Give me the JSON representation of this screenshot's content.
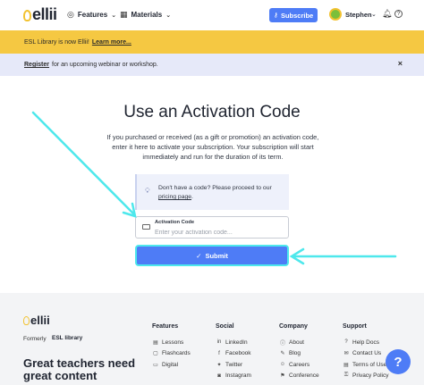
{
  "header": {
    "logo_text": "ellii",
    "nav": [
      {
        "label": "Features",
        "icon": "globe-icon"
      },
      {
        "label": "Materials",
        "icon": "grid-icon"
      }
    ],
    "subscribe_label": "Subscribe",
    "user_name": "Stephen"
  },
  "banners": {
    "yellow": {
      "text": "ESL Library is now Ellii!",
      "link": "Learn more..."
    },
    "blue": {
      "link": "Register",
      "text": "for an upcoming webinar or workshop.",
      "close": "×"
    }
  },
  "main": {
    "title": "Use an Activation Code",
    "description": "If you purchased or received (as a gift or promotion) an activation code, enter it here to activate your subscription. Your subscription will start immediately and run for the duration of its term.",
    "info_text": "Don't have a code? Please proceed to our",
    "info_link": "pricing page",
    "info_end": ".",
    "field_label": "Activation Code",
    "field_placeholder": "Enter your activation code...",
    "field_value": "",
    "submit_label": "Submit"
  },
  "annotations": {
    "arrow_color": "#4ee8ec"
  },
  "footer": {
    "logo_text": "ellii",
    "formerly_label": "Formerly",
    "formerly_brand": "ESL library",
    "tagline": "Great teachers need great content",
    "columns": [
      {
        "title": "Features",
        "items": [
          {
            "label": "Lessons",
            "icon": "book-icon"
          },
          {
            "label": "Flashcards",
            "icon": "cards-icon"
          },
          {
            "label": "Digital",
            "icon": "screen-icon"
          }
        ]
      },
      {
        "title": "Social",
        "items": [
          {
            "label": "LinkedIn",
            "icon": "linkedin-icon"
          },
          {
            "label": "Facebook",
            "icon": "facebook-icon"
          },
          {
            "label": "Twitter",
            "icon": "twitter-icon"
          },
          {
            "label": "Instagram",
            "icon": "instagram-icon"
          }
        ]
      },
      {
        "title": "Company",
        "items": [
          {
            "label": "About",
            "icon": "info-icon"
          },
          {
            "label": "Blog",
            "icon": "blog-icon"
          },
          {
            "label": "Careers",
            "icon": "careers-icon"
          },
          {
            "label": "Conference",
            "icon": "conference-icon"
          }
        ]
      },
      {
        "title": "Support",
        "items": [
          {
            "label": "Help Docs",
            "icon": "help-icon"
          },
          {
            "label": "Contact Us",
            "icon": "mail-icon"
          },
          {
            "label": "Terms of Use",
            "icon": "document-icon"
          },
          {
            "label": "Privacy Policy",
            "icon": "lock-icon"
          }
        ]
      }
    ],
    "help_fab": "?"
  },
  "colors": {
    "brand_blue": "#4e7cf6",
    "banner_yellow": "#f5c842",
    "banner_blue": "#e6e9f9",
    "highlight_cyan": "#4ee8ec"
  }
}
